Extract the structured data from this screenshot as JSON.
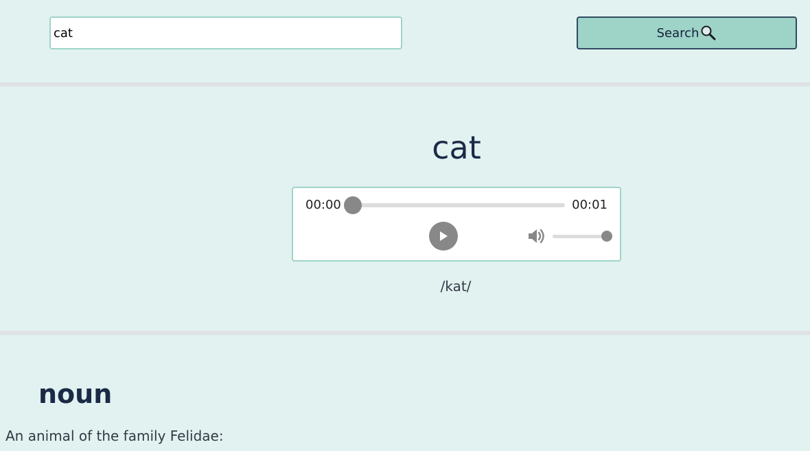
{
  "search": {
    "value": "cat",
    "button_label": "Search",
    "button_icon": "magnifier-icon"
  },
  "entry": {
    "word": "cat",
    "phonetic": "/kat/"
  },
  "audio": {
    "current_time": "00:00",
    "duration": "00:01",
    "progress": 0,
    "volume": 1.0,
    "play_icon": "play-icon",
    "volume_icon": "speaker-icon"
  },
  "meaning": {
    "part_of_speech": "noun",
    "definition": "An animal of the family Felidae:"
  },
  "colors": {
    "background": "#e1f2f1",
    "accent": "#9ed3c7",
    "border": "#a0d4c8",
    "text": "#1b2a45"
  }
}
